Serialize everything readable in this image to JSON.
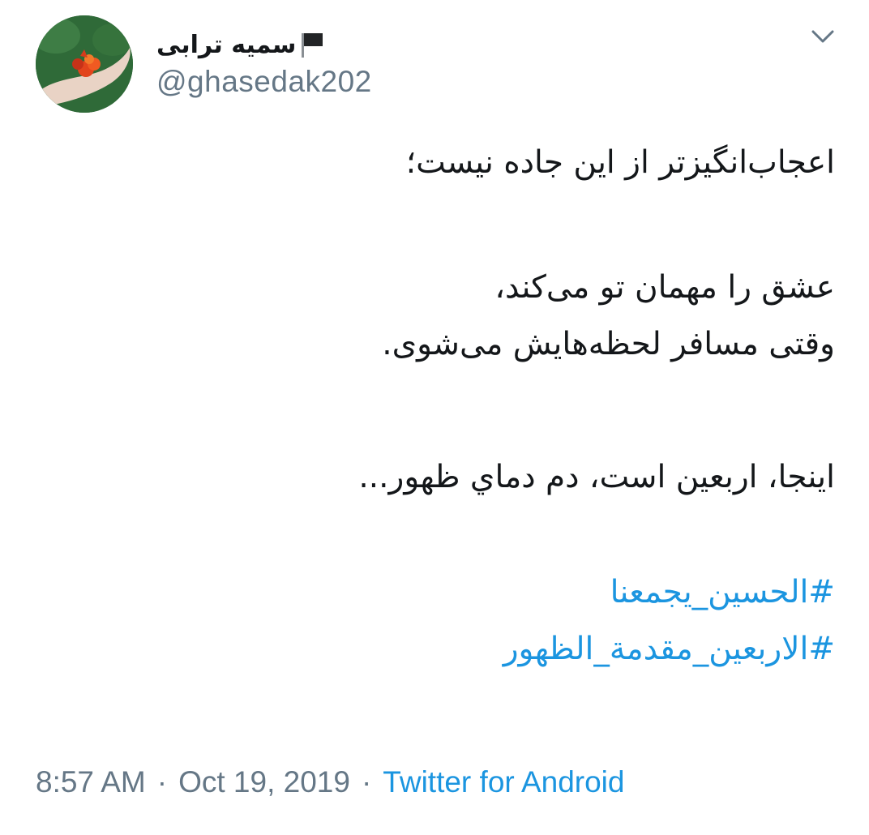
{
  "user": {
    "display_name": "سمیه ترابی",
    "handle": "@ghasedak202",
    "flag_icon": "black-flag-icon",
    "avatar_icon": "hand-holding-flowers-avatar"
  },
  "menu": {
    "caret_icon": "chevron-down-icon"
  },
  "tweet": {
    "lines": [
      "اعجاب‌انگیزتر از این جاده نیست؛",
      "",
      "عشق را مهمان تو می‌کند،",
      "وقتی مسافر لحظه‌هایش می‌شوی.",
      "",
      "اینجا، اربعین است، دم دماي ظهور...",
      ""
    ],
    "hashtags": [
      "#الحسين_يجمعنا",
      "#الاربعين_مقدمة_الظهور"
    ]
  },
  "meta": {
    "time": "8:57 AM",
    "separator": "·",
    "date": "Oct 19, 2019",
    "source": "Twitter for Android"
  },
  "colors": {
    "link": "#1b95e0",
    "secondary_text": "#657786",
    "primary_text": "#14171a"
  }
}
